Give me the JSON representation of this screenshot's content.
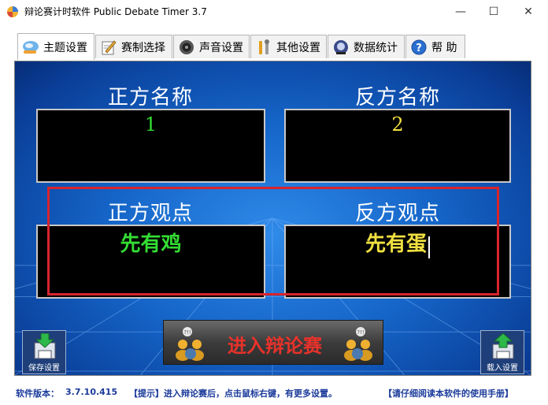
{
  "window": {
    "title": "辩论赛计时软件 Public Debate Timer 3.7",
    "minimize_glyph": "—",
    "maximize_glyph": "☐",
    "close_glyph": "✕"
  },
  "tabs": [
    {
      "label": "主题设置",
      "icon": "theme-icon",
      "active": true
    },
    {
      "label": "赛制选择",
      "icon": "pencil-icon",
      "active": false
    },
    {
      "label": "声音设置",
      "icon": "speaker-icon",
      "active": false
    },
    {
      "label": "其他设置",
      "icon": "tools-icon",
      "active": false
    },
    {
      "label": "数据统计",
      "icon": "stats-icon",
      "active": false
    },
    {
      "label": "帮  助",
      "icon": "help-icon",
      "active": false
    }
  ],
  "main": {
    "pro_name_label": "正方名称",
    "con_name_label": "反方名称",
    "pro_name_value": "1",
    "con_name_value": "2",
    "pro_view_label": "正方观点",
    "con_view_label": "反方观点",
    "pro_view_value": "先有鸡",
    "con_view_value": "先有蛋",
    "enter_button": "进入辩论赛",
    "save_button": "保存设置",
    "load_button": "载入设置"
  },
  "colors": {
    "pro_text": "#33dd33",
    "con_text": "#f0e040",
    "highlight": "#d8242c"
  },
  "status": {
    "version_label": "软件版本：",
    "version_value": "3.7.10.415",
    "tip": "【提示】进入辩论赛后，点击鼠标右键，有更多设置。",
    "manual": "【请仔细阅读本软件的使用手册】"
  }
}
